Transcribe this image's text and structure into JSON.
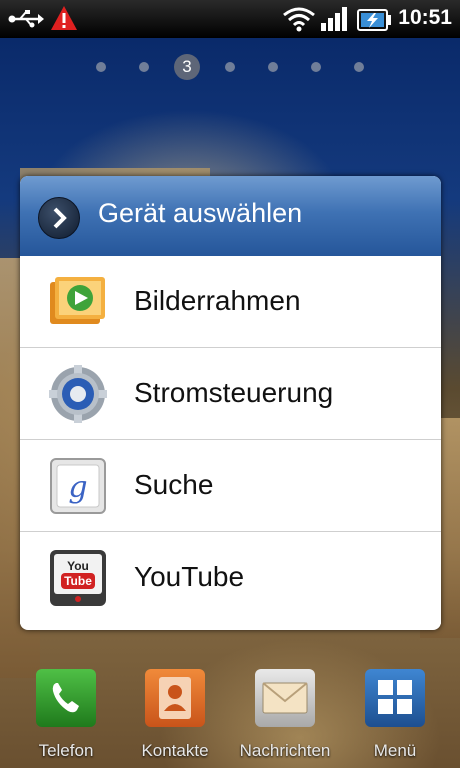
{
  "status_bar": {
    "time": "10:51",
    "icons": [
      "usb-icon",
      "warning-icon",
      "wifi-icon",
      "signal-icon",
      "battery-charging-icon"
    ]
  },
  "home_screen": {
    "current_page": "3"
  },
  "dialog": {
    "title": "Gerät auswählen",
    "header_icon": "chevron-right-icon",
    "items": [
      {
        "label": "Bilderrahmen",
        "icon": "picture-frame-icon"
      },
      {
        "label": "Stromsteuerung",
        "icon": "power-control-gear-icon"
      },
      {
        "label": "Suche",
        "icon": "google-search-icon"
      },
      {
        "label": "YouTube",
        "icon": "youtube-icon"
      }
    ]
  },
  "dock": {
    "items": [
      {
        "label": "Telefon",
        "icon": "phone-icon",
        "color": "#2f9a2a"
      },
      {
        "label": "Kontakte",
        "icon": "contacts-icon",
        "color": "#e06a1c"
      },
      {
        "label": "Nachrichten",
        "icon": "messages-icon",
        "color": "#c9c9c9"
      },
      {
        "label": "Menü",
        "icon": "menu-grid-icon",
        "color": "#2a6fb8"
      }
    ]
  },
  "colors": {
    "dialog_header": "#3f72b4",
    "status_bar": "#000000",
    "warning": "#e02020"
  }
}
